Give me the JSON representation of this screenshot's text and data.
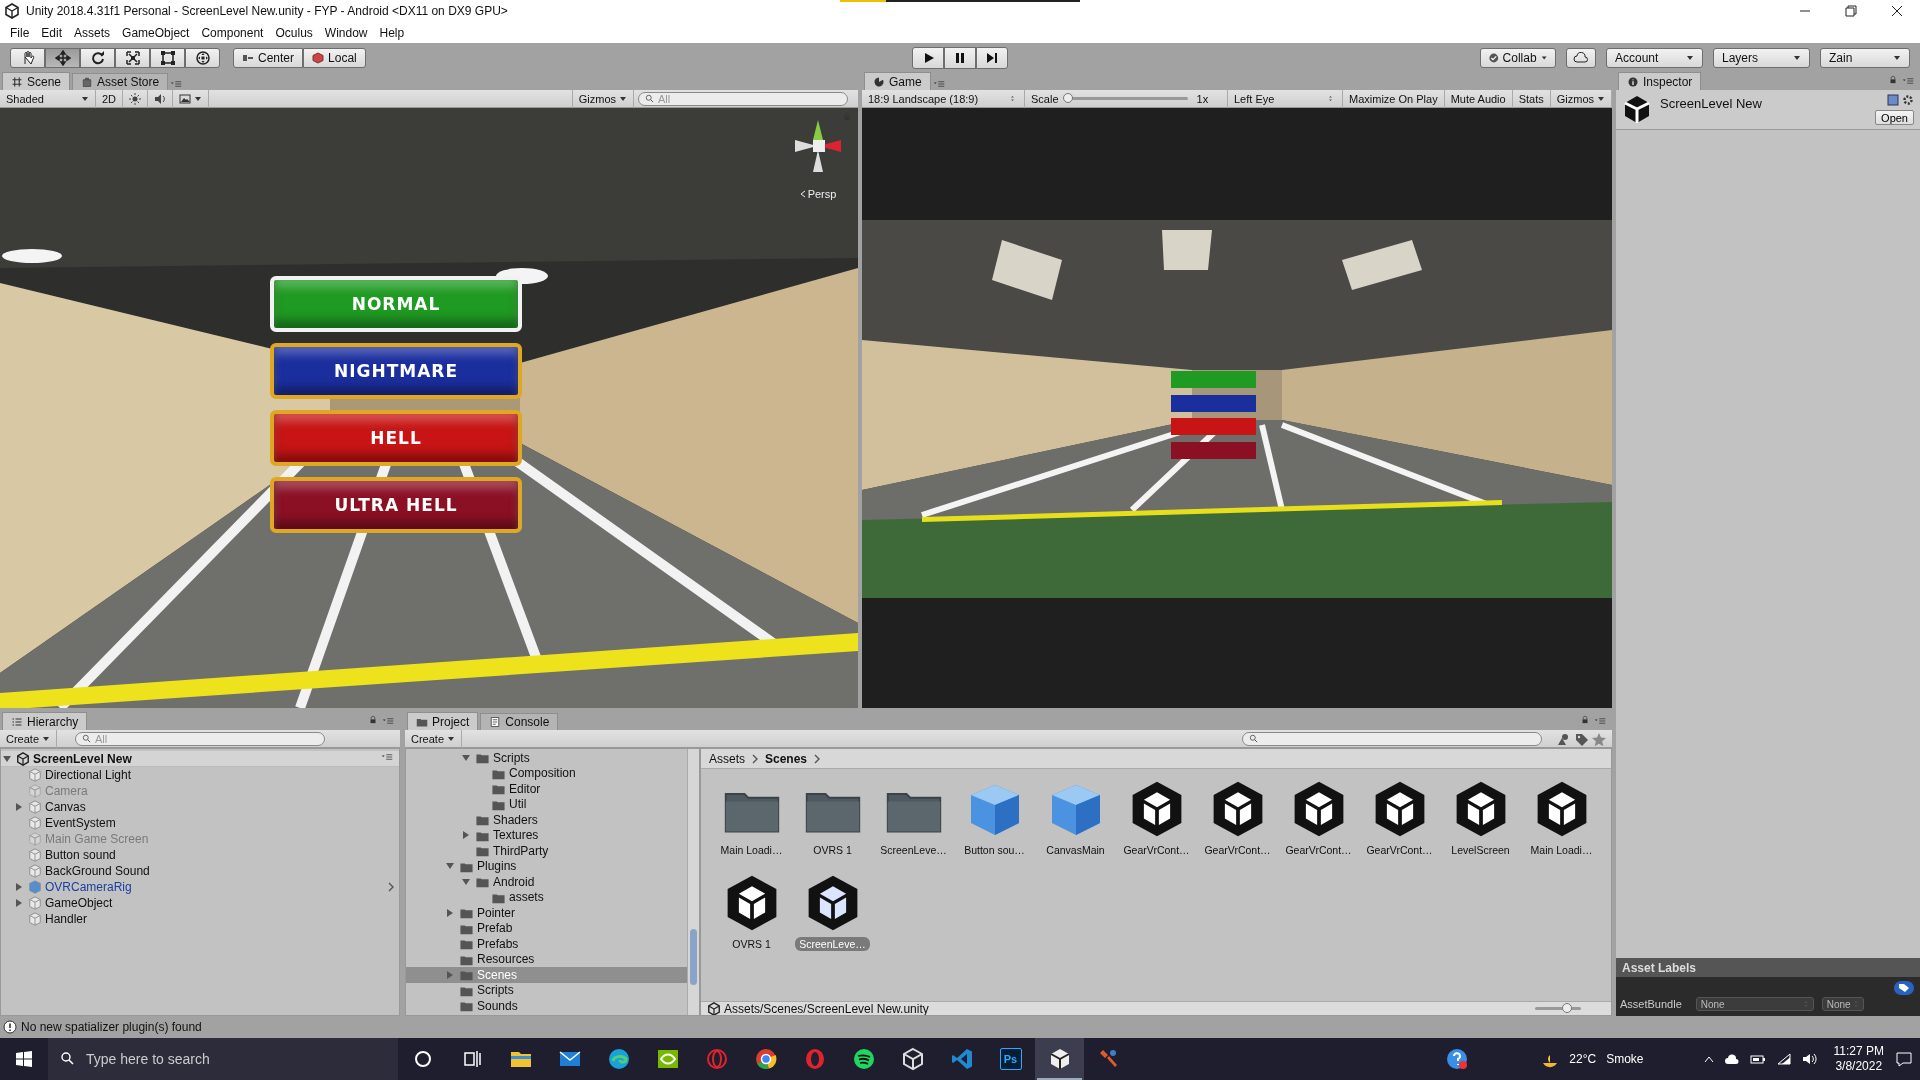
{
  "window": {
    "title": "Unity 2018.4.31f1 Personal - ScreenLevel New.unity - FYP - Android <DX11 on DX9 GPU>",
    "progress": {
      "level": 0.19
    }
  },
  "menu": [
    "File",
    "Edit",
    "Assets",
    "GameObject",
    "Component",
    "Oculus",
    "Window",
    "Help"
  ],
  "toolbar": {
    "tools": [
      {
        "kind": "hand",
        "selected": false
      },
      {
        "kind": "move",
        "selected": true
      },
      {
        "kind": "rotate",
        "selected": false
      },
      {
        "kind": "scale",
        "selected": false
      },
      {
        "kind": "rect",
        "selected": false
      },
      {
        "kind": "transform",
        "selected": false
      }
    ],
    "pivot": [
      "Center",
      "Local"
    ],
    "playback": [
      {
        "kind": "play"
      },
      {
        "kind": "pause"
      },
      {
        "kind": "step"
      }
    ],
    "collab": "Collab",
    "account": "Account",
    "layers": "Layers",
    "layout": "Zain"
  },
  "scene_panel": {
    "tabs": [
      {
        "label": "Scene",
        "selected": true
      },
      {
        "label": "Asset Store",
        "selected": false
      }
    ],
    "shading": "Shaded",
    "mode_2d": "2D",
    "gizmos": "Gizmos",
    "search_placeholder": "All",
    "view": {
      "kind": "picture"
    },
    "gizmo_label": "Persp",
    "menu_buttons": [
      {
        "label": "NORMAL",
        "color": "#1f9a22",
        "highlighted": true
      },
      {
        "label": "NIGHTMARE",
        "color": "#1b2e9e",
        "highlighted": false
      },
      {
        "label": "HELL",
        "color": "#c81414",
        "highlighted": false
      },
      {
        "label": "ULTRA HELL",
        "color": "#8c1024",
        "highlighted": false
      }
    ]
  },
  "game_panel": {
    "tab": "Game",
    "aspect": "18:9 Landscape (18:9)",
    "scale_label": "Scale",
    "scale": {
      "level": 0
    },
    "scale_value": "1x",
    "eye": "Left Eye",
    "toggles": [
      "Maximize On Play",
      "Mute Audio",
      "Stats"
    ],
    "gizmos": "Gizmos",
    "view": {
      "kind": "picture"
    }
  },
  "inspector": {
    "tab": "Inspector",
    "object_name": "ScreenLevel New",
    "open_button": "Open",
    "asset_labels": "Asset Labels",
    "asset_bundle_label": "AssetBundle",
    "asset_bundle_values": [
      "None",
      "None"
    ]
  },
  "hierarchy": {
    "tab": "Hierarchy",
    "create": "Create",
    "search_placeholder": "All",
    "scene": "ScreenLevel New",
    "items": [
      {
        "name": "Directional Light",
        "active": true,
        "prefab": false
      },
      {
        "name": "Camera",
        "active": false,
        "prefab": false
      },
      {
        "name": "Canvas",
        "active": true,
        "prefab": false,
        "expanded": false
      },
      {
        "name": "EventSystem",
        "active": true,
        "prefab": false
      },
      {
        "name": "Main Game Screen",
        "active": false,
        "prefab": false
      },
      {
        "name": "Button sound",
        "active": true,
        "prefab": false
      },
      {
        "name": "BackGround Sound",
        "active": true,
        "prefab": false
      },
      {
        "name": "OVRCameraRig",
        "active": true,
        "prefab": true,
        "expanded": false
      },
      {
        "name": "GameObject",
        "active": true,
        "prefab": false,
        "expanded": false
      },
      {
        "name": "Handler",
        "active": true,
        "prefab": false
      }
    ]
  },
  "project": {
    "tabs": [
      {
        "label": "Project",
        "selected": true
      },
      {
        "label": "Console",
        "selected": false
      }
    ],
    "create": "Create",
    "tree": {
      "scrolled_children": [
        {
          "name": "Scripts",
          "selected": false,
          "expanded": true,
          "children": [
            {
              "name": "Composition",
              "selected": false
            },
            {
              "name": "Editor",
              "selected": false
            },
            {
              "name": "Util",
              "selected": false
            }
          ]
        },
        {
          "name": "Shaders",
          "selected": false
        },
        {
          "name": "Textures",
          "selected": false,
          "expanded": false
        },
        {
          "name": "ThirdParty",
          "selected": false
        }
      ],
      "items": [
        {
          "name": "Plugins",
          "selected": false,
          "expanded": true,
          "children": [
            {
              "name": "Android",
              "selected": false,
              "expanded": true,
              "children": [
                {
                  "name": "assets",
                  "selected": false
                }
              ]
            }
          ]
        },
        {
          "name": "Pointer",
          "selected": false,
          "expanded": false
        },
        {
          "name": "Prefab",
          "selected": false
        },
        {
          "name": "Prefabs",
          "selected": false
        },
        {
          "name": "Resources",
          "selected": false
        },
        {
          "name": "Scenes",
          "selected": true,
          "expanded": false
        },
        {
          "name": "Scripts",
          "selected": false
        },
        {
          "name": "Sounds",
          "selected": false
        }
      ]
    },
    "breadcrumb": [
      "Assets",
      "Scenes"
    ],
    "assets": [
      {
        "name": "Main Loadi…",
        "kind": "folder",
        "selected": false
      },
      {
        "name": "OVRS 1",
        "kind": "folder",
        "selected": false
      },
      {
        "name": "ScreenLeve…",
        "kind": "folder",
        "selected": false
      },
      {
        "name": "Button sou…",
        "kind": "prefab",
        "selected": false
      },
      {
        "name": "CanvasMain",
        "kind": "prefab",
        "selected": false
      },
      {
        "name": "GearVrCont…",
        "kind": "scene",
        "selected": false
      },
      {
        "name": "GearVrCont…",
        "kind": "scene",
        "selected": false
      },
      {
        "name": "GearVrCont…",
        "kind": "scene",
        "selected": false
      },
      {
        "name": "GearVrCont…",
        "kind": "scene",
        "selected": false
      },
      {
        "name": "LevelScreen",
        "kind": "scene",
        "selected": false
      },
      {
        "name": "Main Loadi…",
        "kind": "scene",
        "selected": false
      },
      {
        "name": "OVRS 1",
        "kind": "scene",
        "selected": false
      },
      {
        "name": "ScreenLeve…",
        "kind": "scene",
        "selected": true
      }
    ],
    "path": "Assets/Scenes/ScreenLevel New.unity",
    "icon_size": {
      "level": 0.7
    }
  },
  "status_bar": {
    "message": "No new spatializer plugin(s) found"
  },
  "taskbar": {
    "search_placeholder": "Type here to search",
    "apps": [
      {
        "kind": "cortana",
        "selected": false
      },
      {
        "kind": "task-view",
        "selected": false
      },
      {
        "kind": "files",
        "selected": false
      },
      {
        "kind": "mail",
        "selected": false
      },
      {
        "kind": "browser",
        "selected": false
      },
      {
        "kind": "gpu",
        "selected": false
      },
      {
        "kind": "ring",
        "selected": false
      },
      {
        "kind": "chrome",
        "selected": false
      },
      {
        "kind": "opera",
        "selected": false
      },
      {
        "kind": "music",
        "selected": false
      },
      {
        "kind": "cube",
        "selected": false
      },
      {
        "kind": "code",
        "selected": false
      },
      {
        "kind": "photoshop",
        "label": "Ps",
        "selected": false
      },
      {
        "kind": "unity",
        "selected": true
      },
      {
        "kind": "tool",
        "selected": false
      }
    ],
    "temperature": "22°C",
    "weather": "Smoke",
    "time": "11:27 PM",
    "date": "3/8/2022"
  }
}
